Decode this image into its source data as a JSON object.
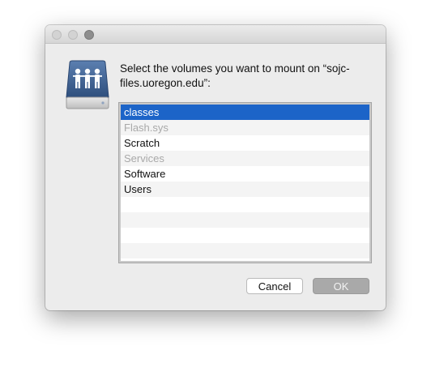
{
  "dialog": {
    "message": "Select the volumes you want to mount on “sojc-files.uoregon.edu”:",
    "volumes": [
      {
        "label": "classes",
        "state": "selected"
      },
      {
        "label": "Flash.sys",
        "state": "disabled"
      },
      {
        "label": "Scratch",
        "state": "normal"
      },
      {
        "label": "Services",
        "state": "disabled"
      },
      {
        "label": "Software",
        "state": "normal"
      },
      {
        "label": "Users",
        "state": "normal"
      }
    ],
    "cancel_label": "Cancel",
    "ok_label": "OK",
    "icon": "network-server-drive-icon"
  },
  "colors": {
    "selection": "#1c64c8",
    "disabled_text": "#a9a9a9",
    "icon_face": "#3b5e8c"
  }
}
